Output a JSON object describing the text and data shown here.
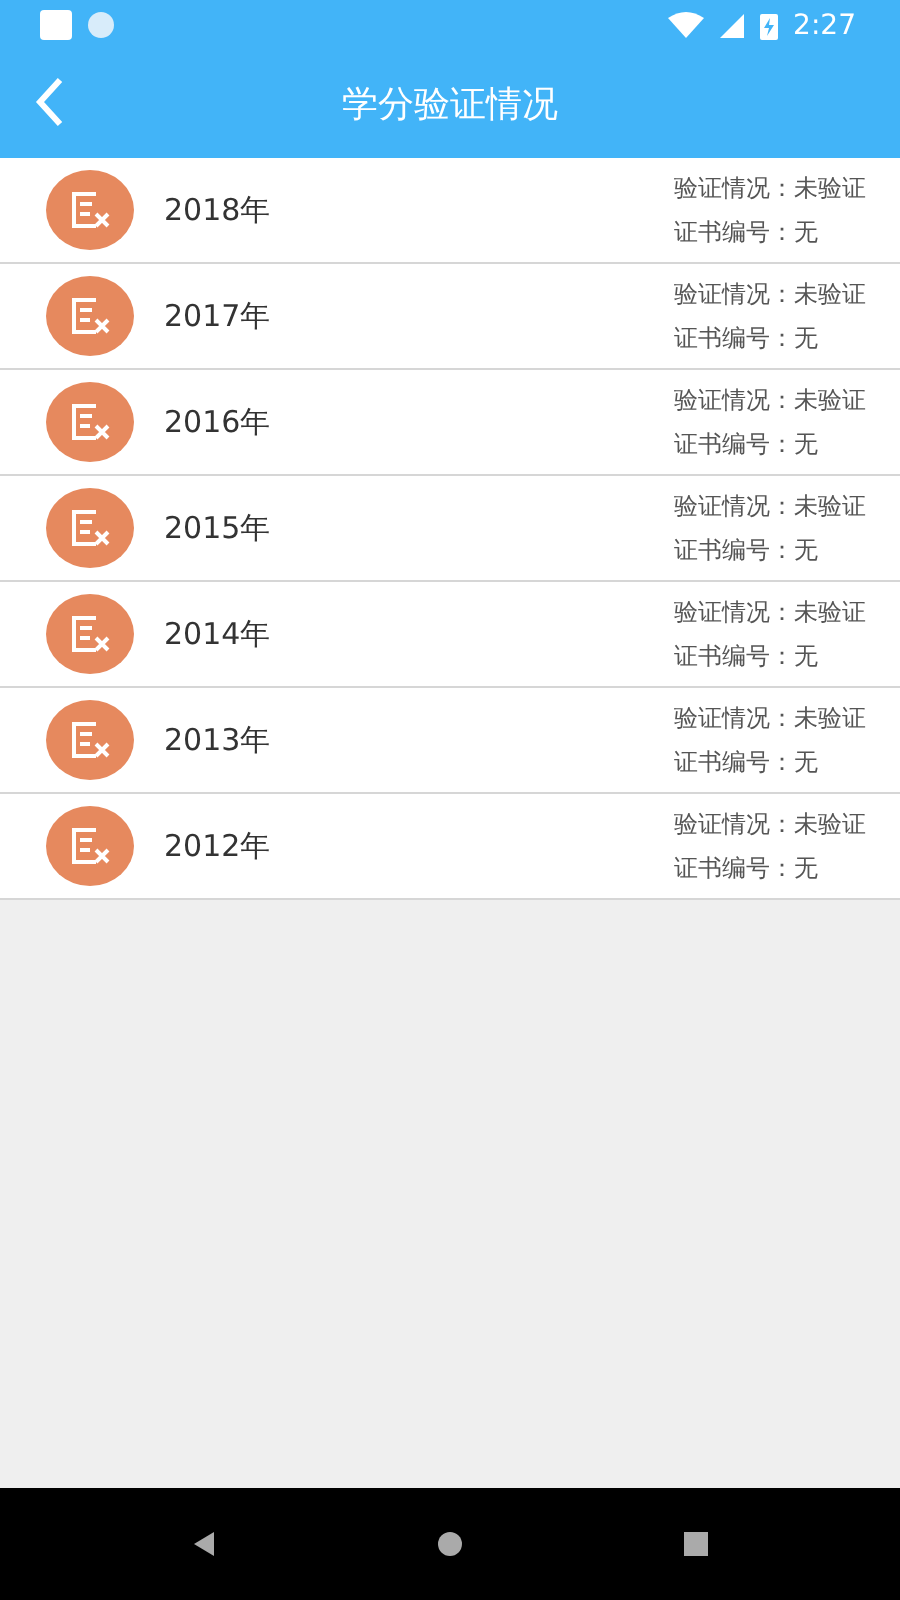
{
  "status_bar": {
    "time": "2:27"
  },
  "header": {
    "title": "学分验证情况"
  },
  "records": [
    {
      "year": "2018年",
      "status": "验证情况：未验证",
      "certificate": "证书编号：无"
    },
    {
      "year": "2017年",
      "status": "验证情况：未验证",
      "certificate": "证书编号：无"
    },
    {
      "year": "2016年",
      "status": "验证情况：未验证",
      "certificate": "证书编号：无"
    },
    {
      "year": "2015年",
      "status": "验证情况：未验证",
      "certificate": "证书编号：无"
    },
    {
      "year": "2014年",
      "status": "验证情况：未验证",
      "certificate": "证书编号：无"
    },
    {
      "year": "2013年",
      "status": "验证情况：未验证",
      "certificate": "证书编号：无"
    },
    {
      "year": "2012年",
      "status": "验证情况：未验证",
      "certificate": "证书编号：无"
    }
  ]
}
